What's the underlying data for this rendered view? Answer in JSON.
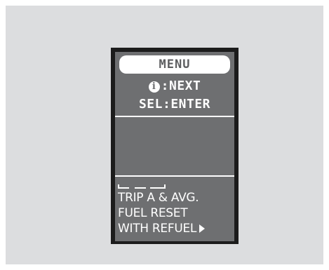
{
  "display": {
    "title": "MENU",
    "next_label": ":NEXT",
    "next_icon": "info-icon",
    "enter_label": "SEL:ENTER",
    "message_lines": [
      "TRIP A & AVG.",
      "FUEL RESET",
      "WITH REFUEL"
    ],
    "more_icon": "right-arrow-icon"
  }
}
